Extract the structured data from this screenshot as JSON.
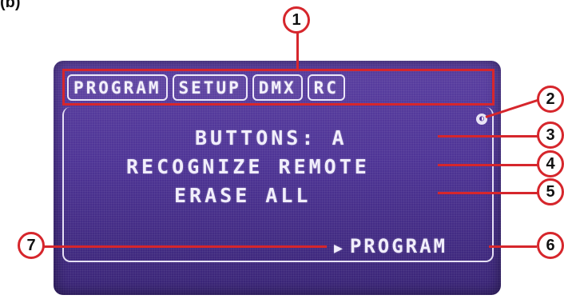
{
  "figure_label": "(b)",
  "lcd": {
    "tabs": [
      "PROGRAM",
      "SETUP",
      "DMX",
      "RC"
    ],
    "lines": [
      "BUTTONS: A",
      "RECOGNIZE REMOTE",
      "ERASE ALL"
    ],
    "action": "PROGRAM",
    "scroll_icon": "scroll-indicator-icon"
  },
  "callouts": [
    "1",
    "2",
    "3",
    "4",
    "5",
    "6",
    "7"
  ],
  "colors": {
    "callout": "#d6262c",
    "lcd_bg": "#4f3597",
    "lcd_text": "#f1eefb"
  }
}
